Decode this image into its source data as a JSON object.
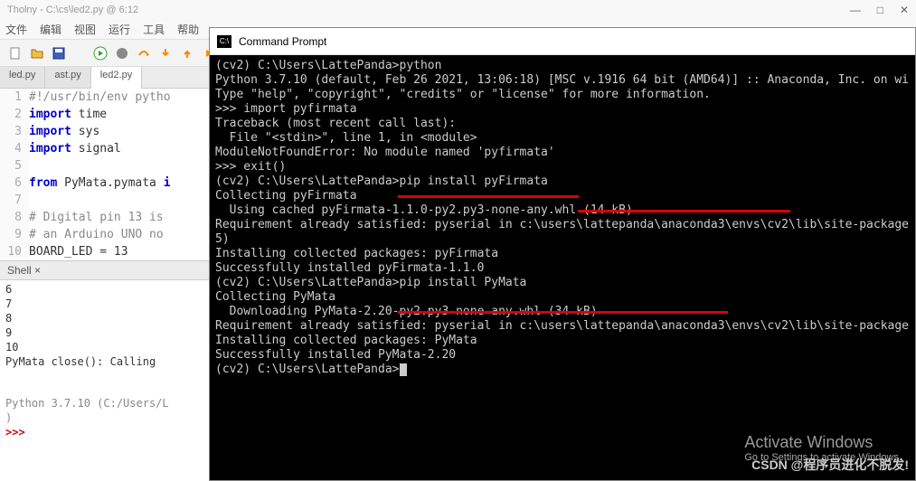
{
  "window": {
    "title": "Tholny - C:\\cs\\led2.py @ 6:12"
  },
  "menu": [
    "文件",
    "编辑",
    "视图",
    "运行",
    "工具",
    "帮助"
  ],
  "tabs": [
    {
      "label": "led.py",
      "active": false
    },
    {
      "label": "ast.py",
      "active": false
    },
    {
      "label": "led2.py",
      "active": true
    }
  ],
  "editor": {
    "lines": [
      {
        "n": "1",
        "pre": "",
        "kw": "",
        "post": "#!/usr/bin/env pytho",
        "comment": true
      },
      {
        "n": "2",
        "pre": "",
        "kw": "import",
        "post": " time"
      },
      {
        "n": "3",
        "pre": "",
        "kw": "import",
        "post": " sys"
      },
      {
        "n": "4",
        "pre": "",
        "kw": "import",
        "post": " signal"
      },
      {
        "n": "5",
        "pre": "",
        "kw": "",
        "post": ""
      },
      {
        "n": "6",
        "pre": "",
        "kw": "from",
        "post": " PyMata.pymata ",
        "kw2": "i"
      },
      {
        "n": "7",
        "pre": "",
        "kw": "",
        "post": ""
      },
      {
        "n": "8",
        "pre": "",
        "kw": "",
        "post": "# Digital pin 13 is",
        "comment": true
      },
      {
        "n": "9",
        "pre": "",
        "kw": "",
        "post": "# an Arduino UNO no",
        "comment": true
      },
      {
        "n": "10",
        "pre": "",
        "kw": "",
        "post": "BOARD_LED = 13",
        "partial": true
      }
    ]
  },
  "shell": {
    "title": "Shell ×",
    "lines": [
      "6",
      "7",
      "8",
      "9",
      "10"
    ],
    "output": "PyMata close(): Calling",
    "status": "Python 3.7.10 (C:/Users/L",
    "status2": ")",
    "prompt": ">>>"
  },
  "cmd": {
    "title": "Command Prompt",
    "lines": [
      "(cv2) C:\\Users\\LattePanda>python",
      "Python 3.7.10 (default, Feb 26 2021, 13:06:18) [MSC v.1916 64 bit (AMD64)] :: Anaconda, Inc. on wi",
      "Type \"help\", \"copyright\", \"credits\" or \"license\" for more information.",
      ">>> import pyfirmata",
      "Traceback (most recent call last):",
      "  File \"<stdin>\", line 1, in <module>",
      "ModuleNotFoundError: No module named 'pyfirmata'",
      ">>> exit()",
      "",
      "(cv2) C:\\Users\\LattePanda>pip install pyFirmata",
      "Collecting pyFirmata",
      "  Using cached pyFirmata-1.1.0-py2.py3-none-any.whl (14 kB)",
      "Requirement already satisfied: pyserial in c:\\users\\lattepanda\\anaconda3\\envs\\cv2\\lib\\site-package",
      "5)",
      "Installing collected packages: pyFirmata",
      "Successfully installed pyFirmata-1.1.0",
      "",
      "(cv2) C:\\Users\\LattePanda>pip install PyMata",
      "Collecting PyMata",
      "  Downloading PyMata-2.20-py2.py3-none-any.whl (34 kB)",
      "Requirement already satisfied: pyserial in c:\\users\\lattepanda\\anaconda3\\envs\\cv2\\lib\\site-package",
      "Installing collected packages: PyMata",
      "Successfully installed PyMata-2.20",
      "",
      "(cv2) C:\\Users\\LattePanda>"
    ]
  },
  "watermark": {
    "activate_h": "Activate Windows",
    "activate_s": "Go to Settings to activate Windows.",
    "csdn": "CSDN @程序员进化不脱发!"
  }
}
